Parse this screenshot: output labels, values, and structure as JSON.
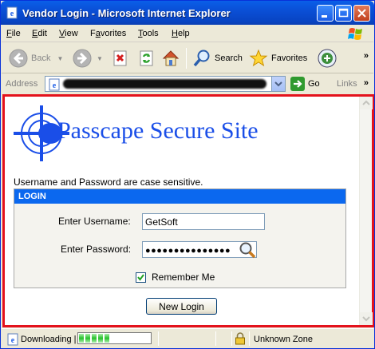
{
  "window": {
    "title": "Vendor Login - Microsoft Internet Explorer"
  },
  "menu": {
    "items": [
      {
        "acc": "F",
        "rest": "ile"
      },
      {
        "acc": "E",
        "rest": "dit"
      },
      {
        "acc": "V",
        "rest": "iew"
      },
      {
        "acc": "",
        "pre": "F",
        "mid": "a",
        "rest": "vorites"
      },
      {
        "acc": "T",
        "rest": "ools"
      },
      {
        "acc": "H",
        "rest": "elp"
      }
    ]
  },
  "toolbar": {
    "back_label": "Back",
    "search_label": "Search",
    "favorites_label": "Favorites",
    "more": "»"
  },
  "address": {
    "label": "Address",
    "go_label": "Go",
    "links_label": "Links",
    "more": "»"
  },
  "page": {
    "site_title": "Passcape Secure Site",
    "notice": "Username and Password are case sensitive.",
    "login_header": "LOGIN",
    "username_label": "Enter Username:",
    "username_value": "GetSoft",
    "password_label": "Enter Password:",
    "password_value": "●●●●●●●●●●●●●●●",
    "remember_label": "Remember Me",
    "remember_checked": true,
    "submit_label": "New Login"
  },
  "status": {
    "text": "Downloading |",
    "progress_segments": 5,
    "zone": "Unknown Zone"
  },
  "colors": {
    "accent": "#0b68ef",
    "highlight_border": "#e4121c",
    "title_text": "#1a4ee8"
  }
}
